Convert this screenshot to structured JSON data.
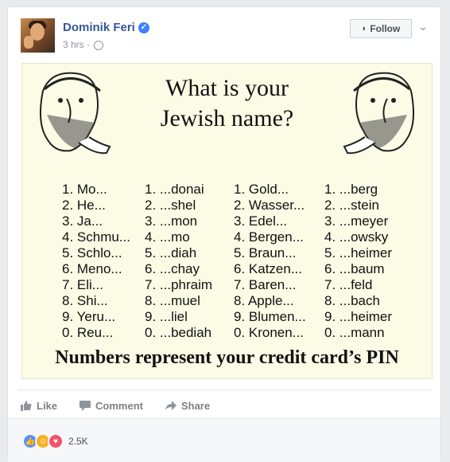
{
  "post": {
    "author": "Dominik Feri",
    "time": "3 hrs",
    "follow_label": "Follow"
  },
  "image": {
    "title": "What is your\nJewish name?",
    "columns": [
      [
        "1. Mo...",
        "2. He...",
        "3. Ja...",
        "4. Schmu...",
        "5. Schlo...",
        "6. Meno...",
        "7. Eli...",
        "8. Shi...",
        "9. Yeru...",
        "0. Reu..."
      ],
      [
        "1. ...donai",
        "2. ...shel",
        "3. ...mon",
        "4. ...mo",
        "5. ...diah",
        "6. ...chay",
        "7. ...phraim",
        "8. ...muel",
        "9. ...liel",
        "0. ...bediah"
      ],
      [
        "1. Gold...",
        "2. Wasser...",
        "3. Edel...",
        "4. Bergen...",
        "5. Braun...",
        "6. Katzen...",
        "7. Baren...",
        "8. Apple...",
        "9. Blumen...",
        "0. Kronen..."
      ],
      [
        "1. ...berg",
        "2. ...stein",
        "3. ...meyer",
        "4. ...owsky",
        "5. ...heimer",
        "6. ...baum",
        "7. ...feld",
        "8. ...bach",
        "9. ...heimer",
        "0. ...mann"
      ]
    ],
    "footer": "Numbers represent your credit card’s PIN"
  },
  "actions": {
    "like": "Like",
    "comment": "Comment",
    "share": "Share"
  },
  "reactions": {
    "count": "2.5K",
    "icons": [
      "like-reaction-icon",
      "haha-reaction-icon",
      "love-reaction-icon"
    ],
    "colors": {
      "like": "#5890ff",
      "haha": "#f7b125",
      "love": "#f25268"
    }
  },
  "colors": {
    "link": "#365899",
    "muted": "#90949c",
    "image_bg": "#fcfce6"
  }
}
